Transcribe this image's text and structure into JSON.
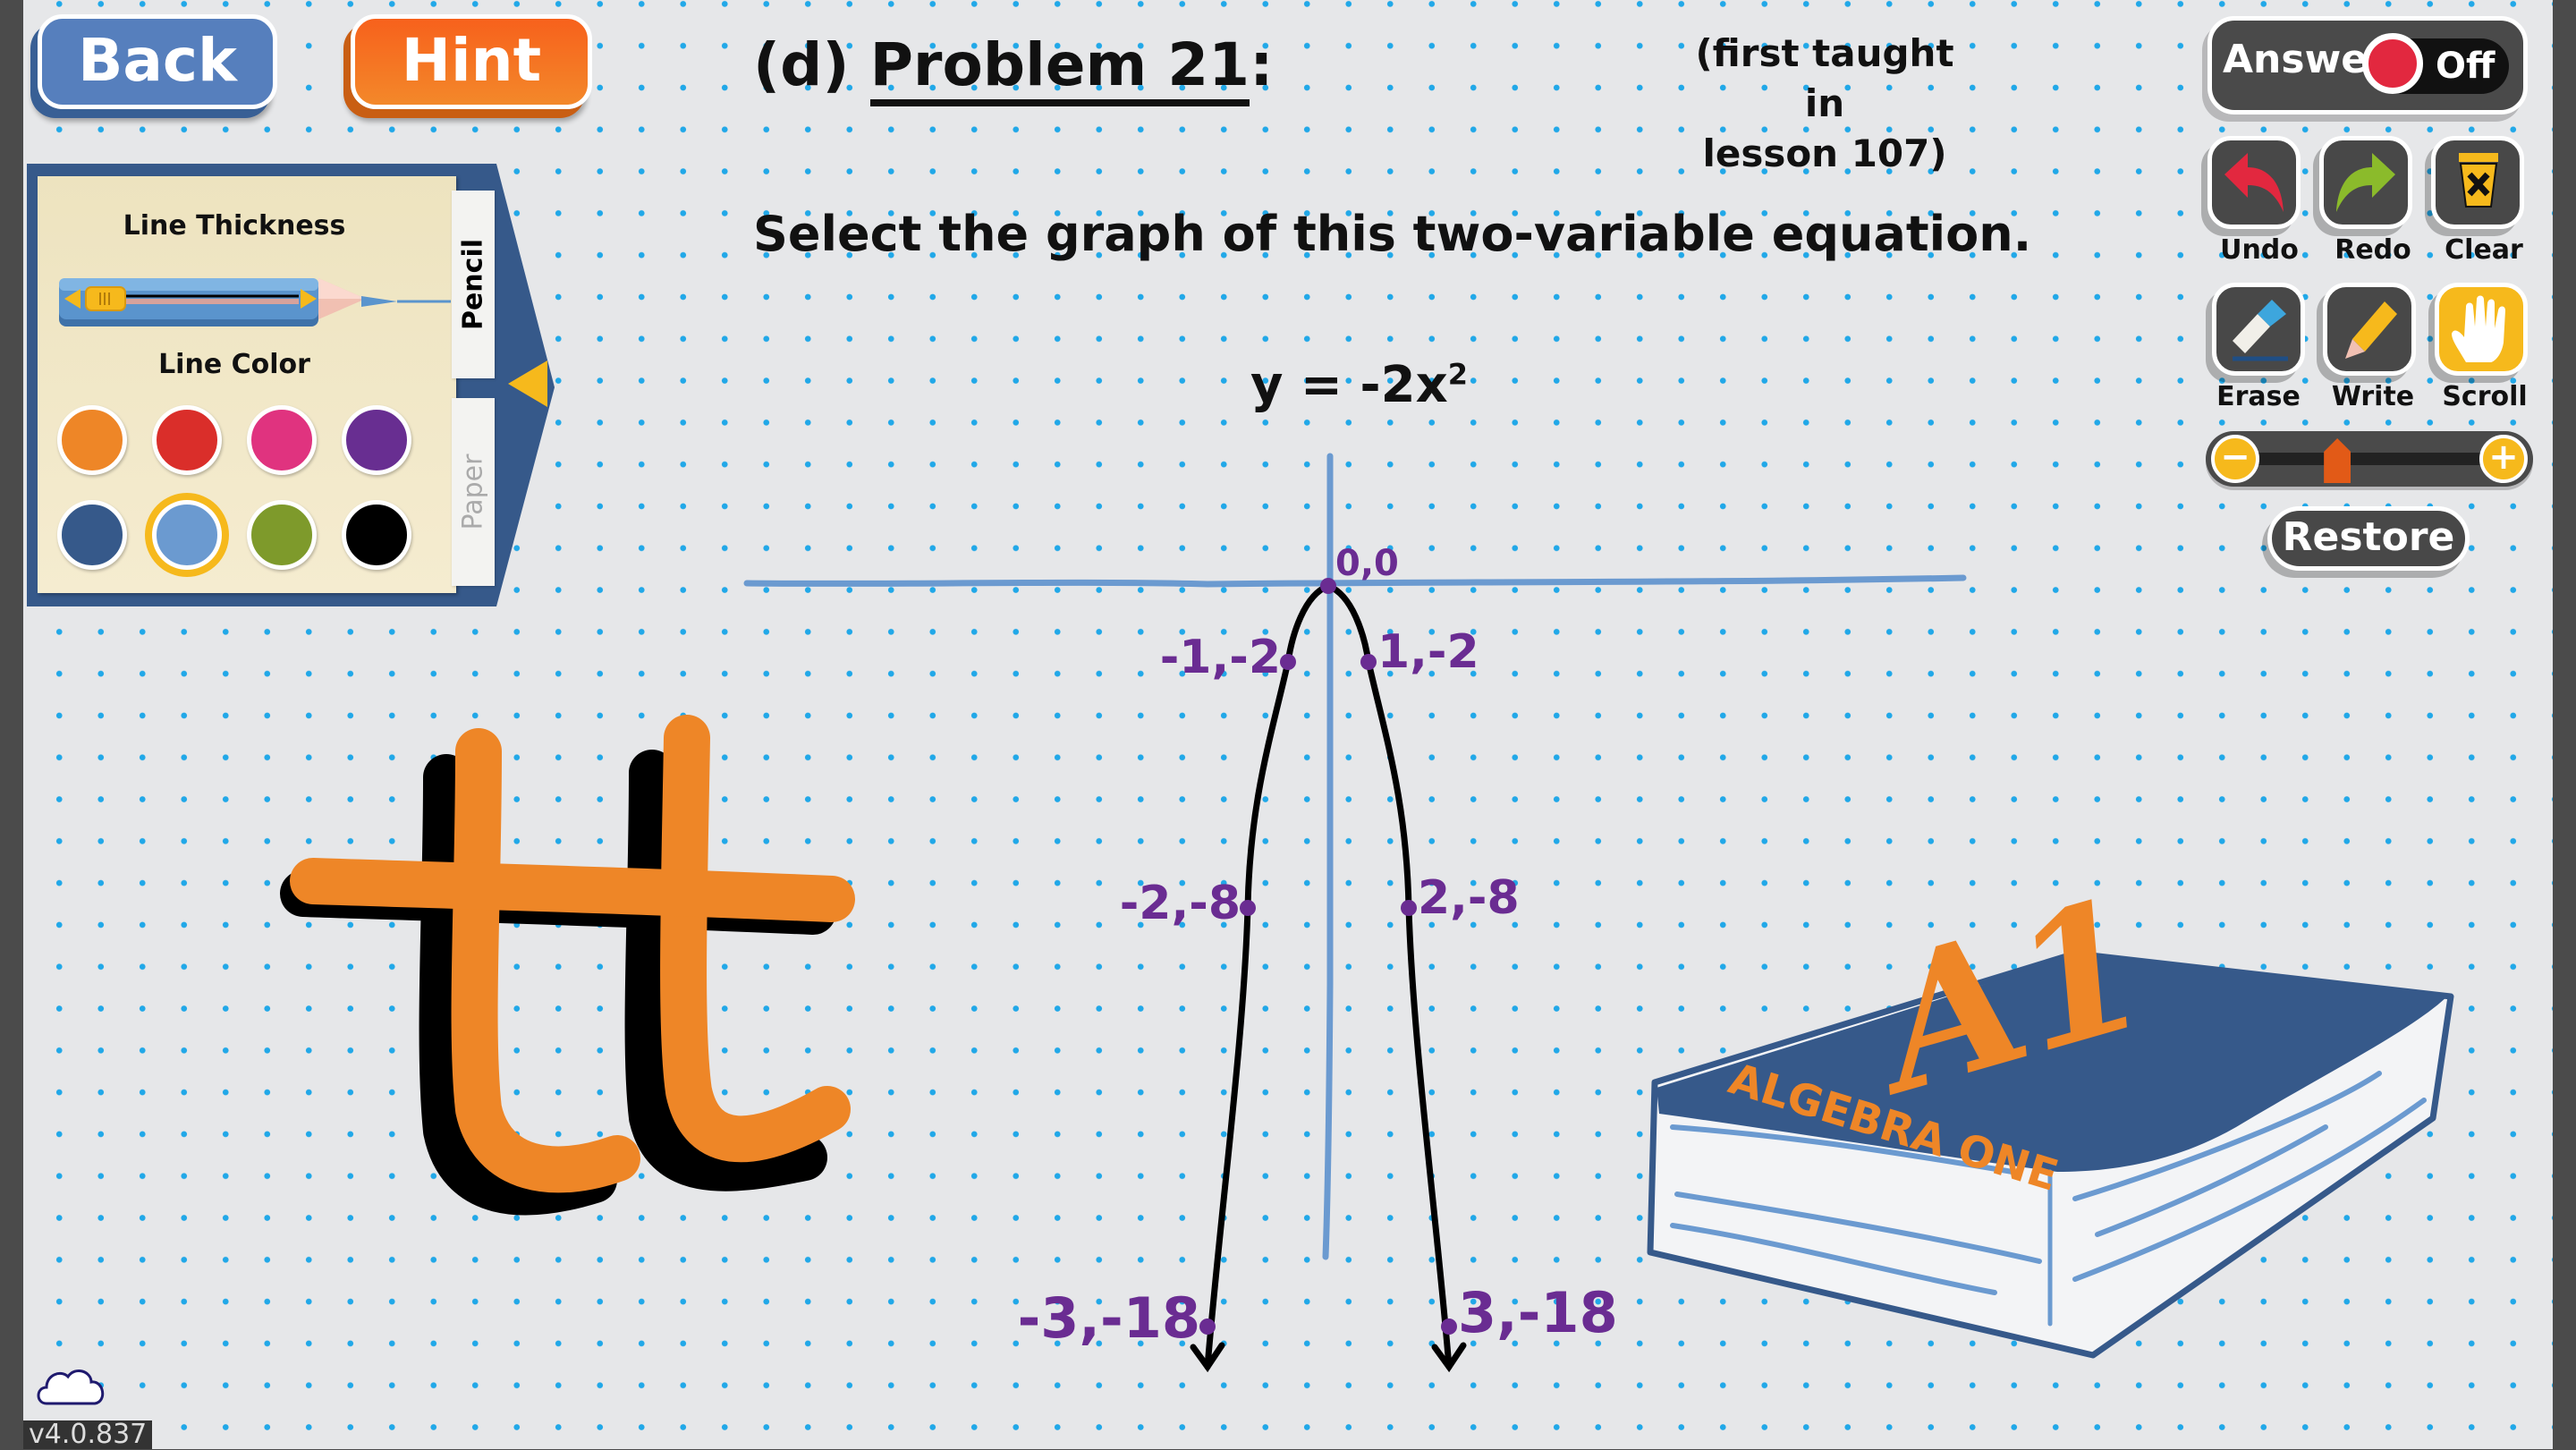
{
  "header": {
    "back_label": "Back",
    "hint_label": "Hint",
    "problem_prefix": "(d)",
    "problem_title": "Problem 21",
    "problem_suffix": ":",
    "lesson_line1": "(first taught in",
    "lesson_line2": "lesson 107)"
  },
  "question": {
    "instruction": "Select the graph of this two-variable equation.",
    "equation_base": "y = -2x",
    "equation_exponent": "2"
  },
  "pencil_panel": {
    "thickness_label": "Line Thickness",
    "thickness_value": 0,
    "color_label": "Line Color",
    "colors": [
      {
        "name": "orange",
        "hex": "#ee8627",
        "selected": false
      },
      {
        "name": "red",
        "hex": "#da2e2a",
        "selected": false
      },
      {
        "name": "pink",
        "hex": "#e0337f",
        "selected": false
      },
      {
        "name": "purple",
        "hex": "#682e91",
        "selected": false
      },
      {
        "name": "navy",
        "hex": "#36598a",
        "selected": false
      },
      {
        "name": "light-blue",
        "hex": "#6b9ad0",
        "selected": true
      },
      {
        "name": "green",
        "hex": "#7e9a2b",
        "selected": false
      },
      {
        "name": "black",
        "hex": "#000000",
        "selected": false
      }
    ],
    "tabs": [
      {
        "label": "Pencil",
        "active": true
      },
      {
        "label": "Paper",
        "active": false
      }
    ]
  },
  "toolbar": {
    "answer_label": "Answer",
    "answer_state": "Off",
    "buttons_row1": [
      {
        "label": "Undo",
        "icon": "undo-arrow-icon"
      },
      {
        "label": "Redo",
        "icon": "redo-arrow-icon"
      },
      {
        "label": "Clear",
        "icon": "trash-clear-icon"
      }
    ],
    "buttons_row2": [
      {
        "label": "Erase",
        "icon": "eraser-icon",
        "active": false
      },
      {
        "label": "Write",
        "icon": "pencil-icon",
        "active": false
      },
      {
        "label": "Scroll",
        "icon": "hand-icon",
        "active": true
      }
    ],
    "zoom_minus": "−",
    "zoom_plus": "+",
    "zoom_level_fraction": 0.34,
    "restore_label": "Restore"
  },
  "drawing": {
    "points": [
      {
        "x": 0,
        "y": 0,
        "label": "0,0"
      },
      {
        "x": -1,
        "y": -2,
        "label": "-1,-2"
      },
      {
        "x": 1,
        "y": -2,
        "label": "1,-2"
      },
      {
        "x": -2,
        "y": -8,
        "label": "-2,-8"
      },
      {
        "x": 2,
        "y": -8,
        "label": "2,-8"
      },
      {
        "x": -3,
        "y": -18,
        "label": "-3,-18"
      },
      {
        "x": 3,
        "y": -18,
        "label": "3,-18"
      }
    ],
    "annotation_color": "#6a2c92",
    "curve_color": "#000000",
    "axis_color": "#6b9ad0",
    "doodle_text": "tt",
    "doodle_color": "#ee8627",
    "book_title_big": "A1",
    "book_title_small": "ALGEBRA ONE"
  },
  "footer": {
    "version": "v4.0.837"
  }
}
